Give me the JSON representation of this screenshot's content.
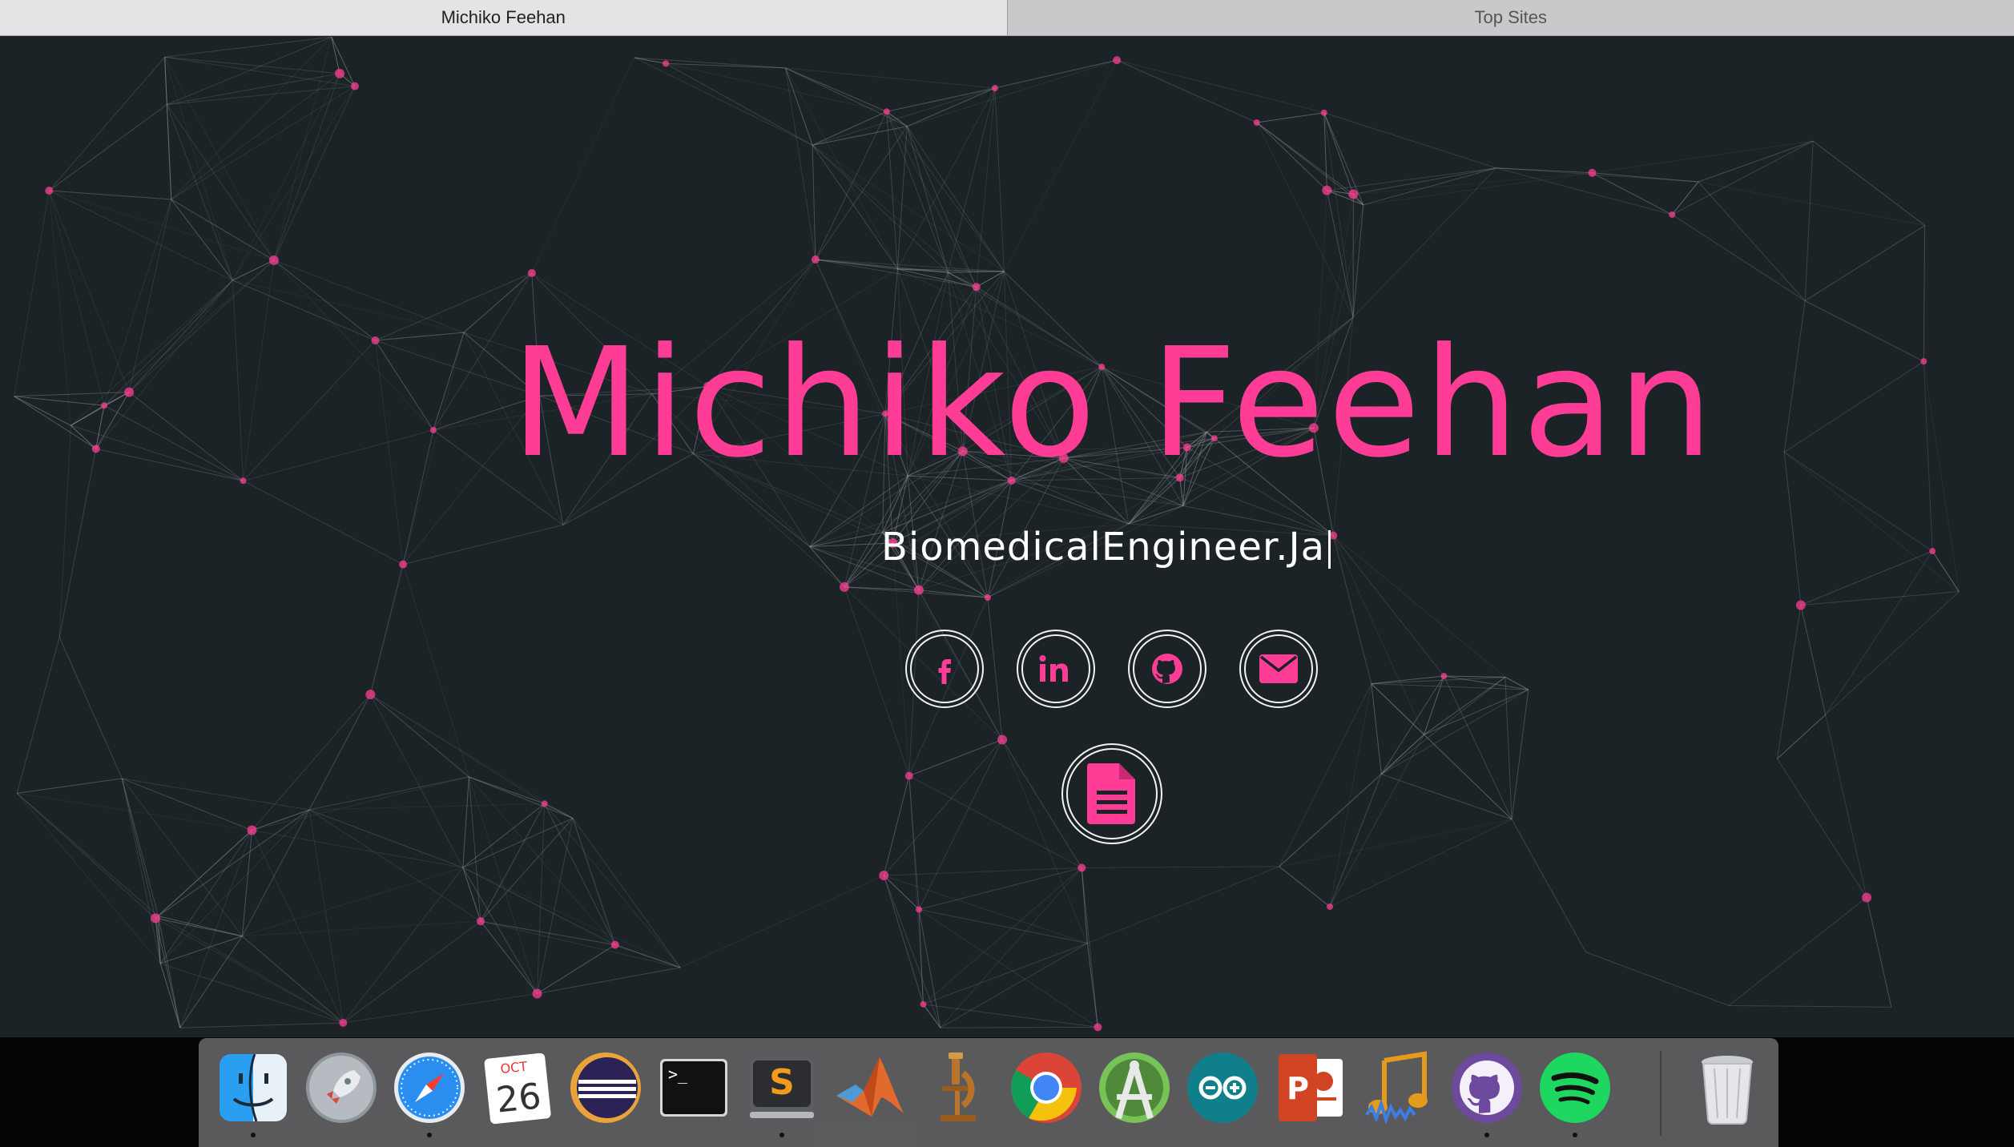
{
  "tabs": [
    {
      "label": "Michiko Feehan",
      "active": true
    },
    {
      "label": "Top Sites",
      "active": false
    }
  ],
  "hero": {
    "name": "Michiko Feehan",
    "typed_text": "BiomedicalEngineer.Ja"
  },
  "social_links": [
    {
      "name": "facebook",
      "icon": "facebook-icon"
    },
    {
      "name": "linkedin",
      "icon": "linkedin-icon"
    },
    {
      "name": "github",
      "icon": "github-icon"
    },
    {
      "name": "email",
      "icon": "envelope-icon"
    },
    {
      "name": "resume",
      "icon": "document-icon"
    }
  ],
  "dock": {
    "calendar_month": "OCT",
    "calendar_day": "26",
    "apps": [
      "Finder",
      "Launchpad",
      "Safari",
      "Calendar",
      "Eclipse",
      "Terminal",
      "Sublime Text",
      "MATLAB",
      "Microscope",
      "Google Chrome",
      "Android Studio",
      "Arduino",
      "PowerPoint",
      "Audio",
      "GitHub Desktop",
      "Spotify",
      "Trash"
    ]
  },
  "colors": {
    "accent": "#ff3d96",
    "background": "#1b2327",
    "line": "#9aa0a0"
  }
}
